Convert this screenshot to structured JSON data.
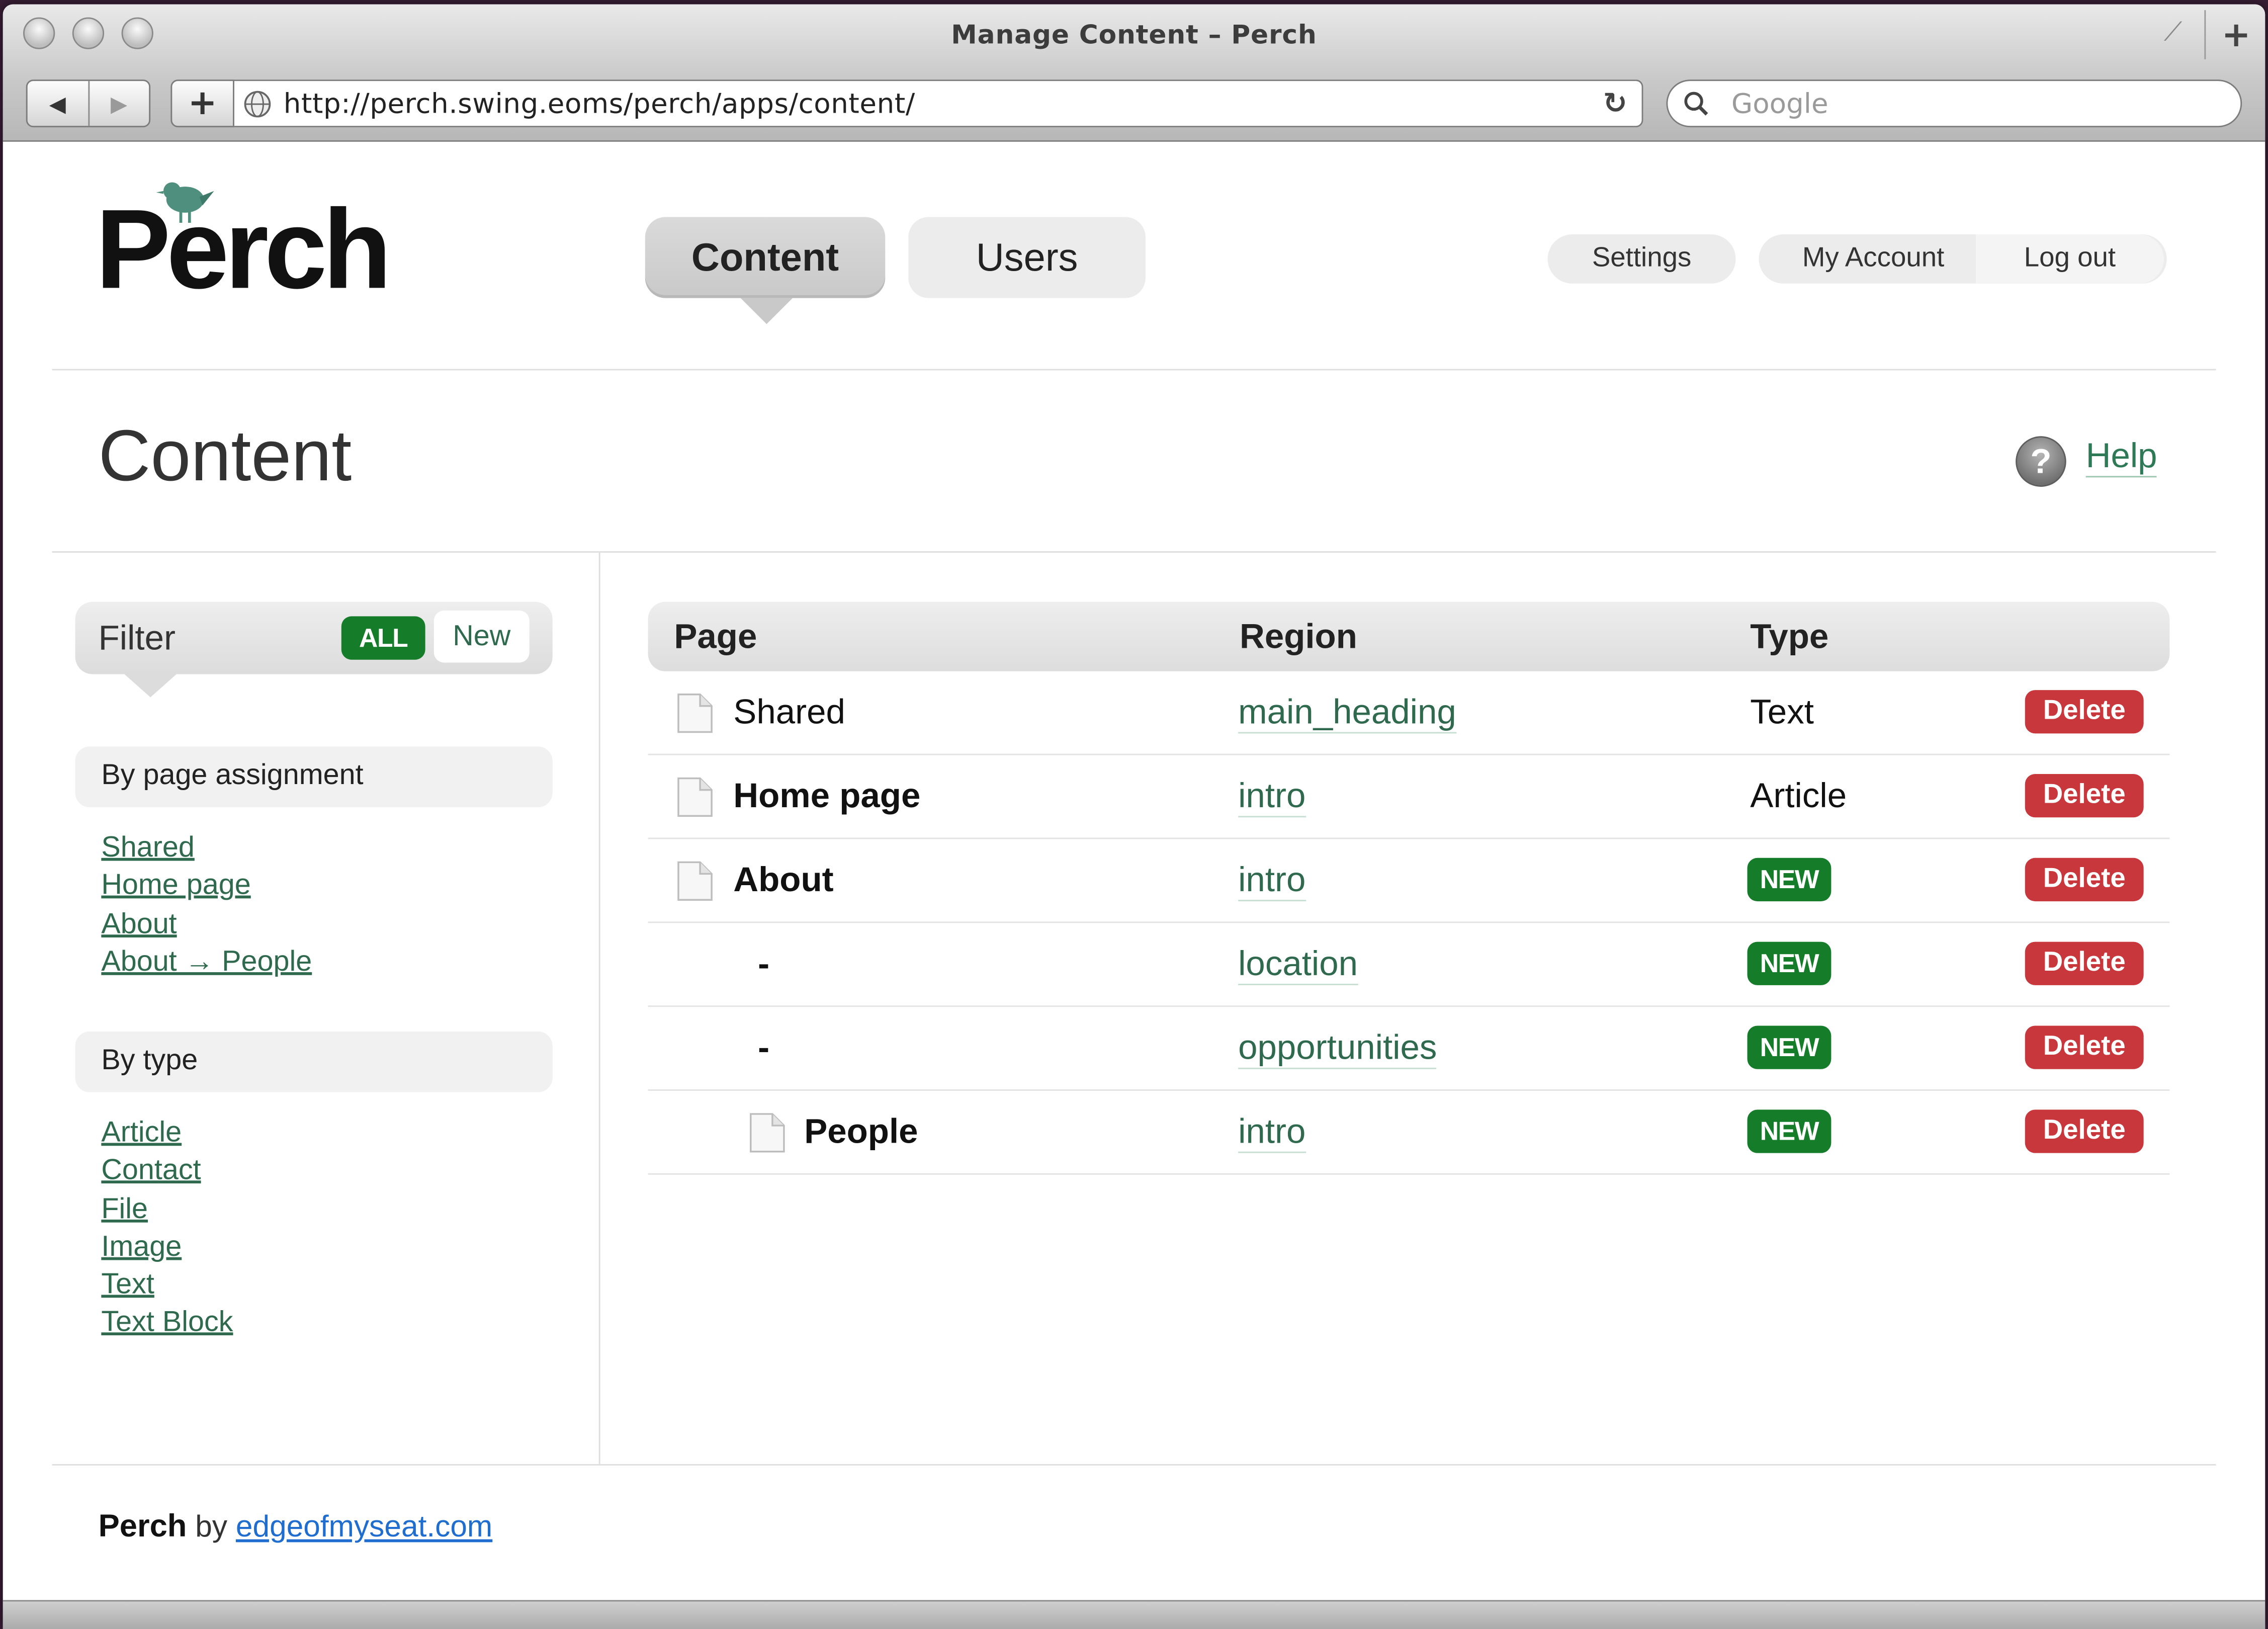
{
  "browser": {
    "window_title": "Manage Content – Perch",
    "url": "http://perch.swing.eoms/perch/apps/content/",
    "search_placeholder": "Google",
    "back": "◀",
    "forward": "▶",
    "new_tab": "+",
    "reload": "↻",
    "corner_plus": "+"
  },
  "header": {
    "logo": "Perch",
    "tabs": [
      {
        "label": "Content",
        "active": true
      },
      {
        "label": "Users",
        "active": false
      }
    ],
    "settings_label": "Settings",
    "my_account_label": "My Account",
    "logout_label": "Log out"
  },
  "page": {
    "title": "Content",
    "help_label": "Help"
  },
  "sidebar": {
    "filter_label": "Filter",
    "filter_all": "ALL",
    "filter_new": "New",
    "by_page_heading": "By page assignment",
    "by_page_links": [
      "Shared",
      "Home page",
      "About",
      "About → People"
    ],
    "by_type_heading": "By type",
    "by_type_links": [
      "Article",
      "Contact",
      "File",
      "Image",
      "Text",
      "Text Block"
    ]
  },
  "table": {
    "headers": {
      "page": "Page",
      "region": "Region",
      "type": "Type"
    },
    "rows": [
      {
        "page": "Shared",
        "region": "main_heading",
        "type": "Text",
        "delete": "Delete"
      },
      {
        "page": "Home page",
        "region": "intro",
        "type": "Article",
        "delete": "Delete"
      },
      {
        "page": "About",
        "region": "intro",
        "type": "NEW",
        "delete": "Delete"
      },
      {
        "page": "-",
        "region": "location",
        "type": "NEW",
        "delete": "Delete"
      },
      {
        "page": "-",
        "region": "opportunities",
        "type": "NEW",
        "delete": "Delete"
      },
      {
        "page": "People",
        "region": "intro",
        "type": "NEW",
        "delete": "Delete"
      }
    ]
  },
  "footer": {
    "brand": "Perch",
    "by": "by",
    "link": "edgeofmyseat.com"
  },
  "colors": {
    "accent_green": "#157d2a",
    "link_green": "#2f6a4f",
    "delete_red": "#c7373c",
    "footer_link_blue": "#1f6ecf"
  }
}
